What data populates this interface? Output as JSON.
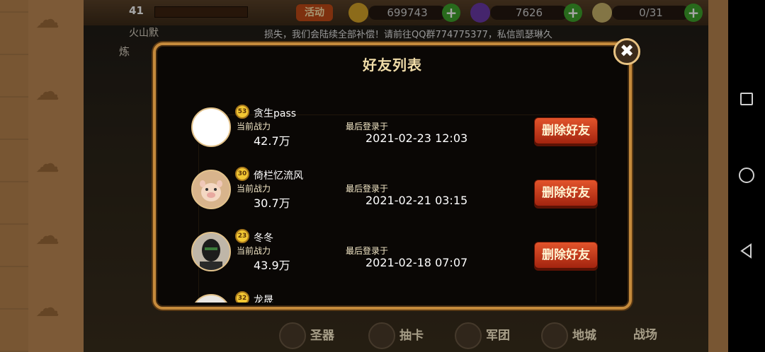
{
  "scene": {
    "player_level": "41",
    "activity_button": "活动",
    "resource1_value": "699743",
    "resource2_value": "7626",
    "resource3_value": "0/31",
    "plus_glyph": "+",
    "notice_text": "损失，我们会陆续全部补偿！请前往QQ群774775377，私信凯瑟琳久",
    "left_label1": "火山默",
    "left_label2": "炼",
    "bottom_buttons": [
      "圣器",
      "抽卡",
      "军团",
      "地城",
      "战场"
    ]
  },
  "dialog": {
    "title": "好友列表",
    "close_glyph": "✖",
    "friends": [
      {
        "level": "53",
        "name": "贪生pass",
        "power_label": "当前战力",
        "power_value": "42.7万",
        "last_login_label": "最后登录于",
        "last_login_value": "2021-02-23  12:03",
        "delete_label": "删除好友",
        "avatar": "blank-avatar"
      },
      {
        "level": "30",
        "name": "倚栏忆流风",
        "power_label": "当前战力",
        "power_value": "30.7万",
        "last_login_label": "最后登录于",
        "last_login_value": "2021-02-21  03:15",
        "delete_label": "删除好友",
        "avatar": "pig-avatar"
      },
      {
        "level": "23",
        "name": "冬冬",
        "power_label": "当前战力",
        "power_value": "43.9万",
        "last_login_label": "最后登录于",
        "last_login_value": "2021-02-18  07:07",
        "delete_label": "删除好友",
        "avatar": "masked-person-avatar"
      },
      {
        "level": "32",
        "name": "龙晟",
        "avatar": "person-avatar"
      }
    ]
  },
  "colors": {
    "dialog_border": "#c58a3c",
    "title": "#f0dca8",
    "delete_button": "#c63b1c",
    "level_badge": "#f2c733"
  }
}
